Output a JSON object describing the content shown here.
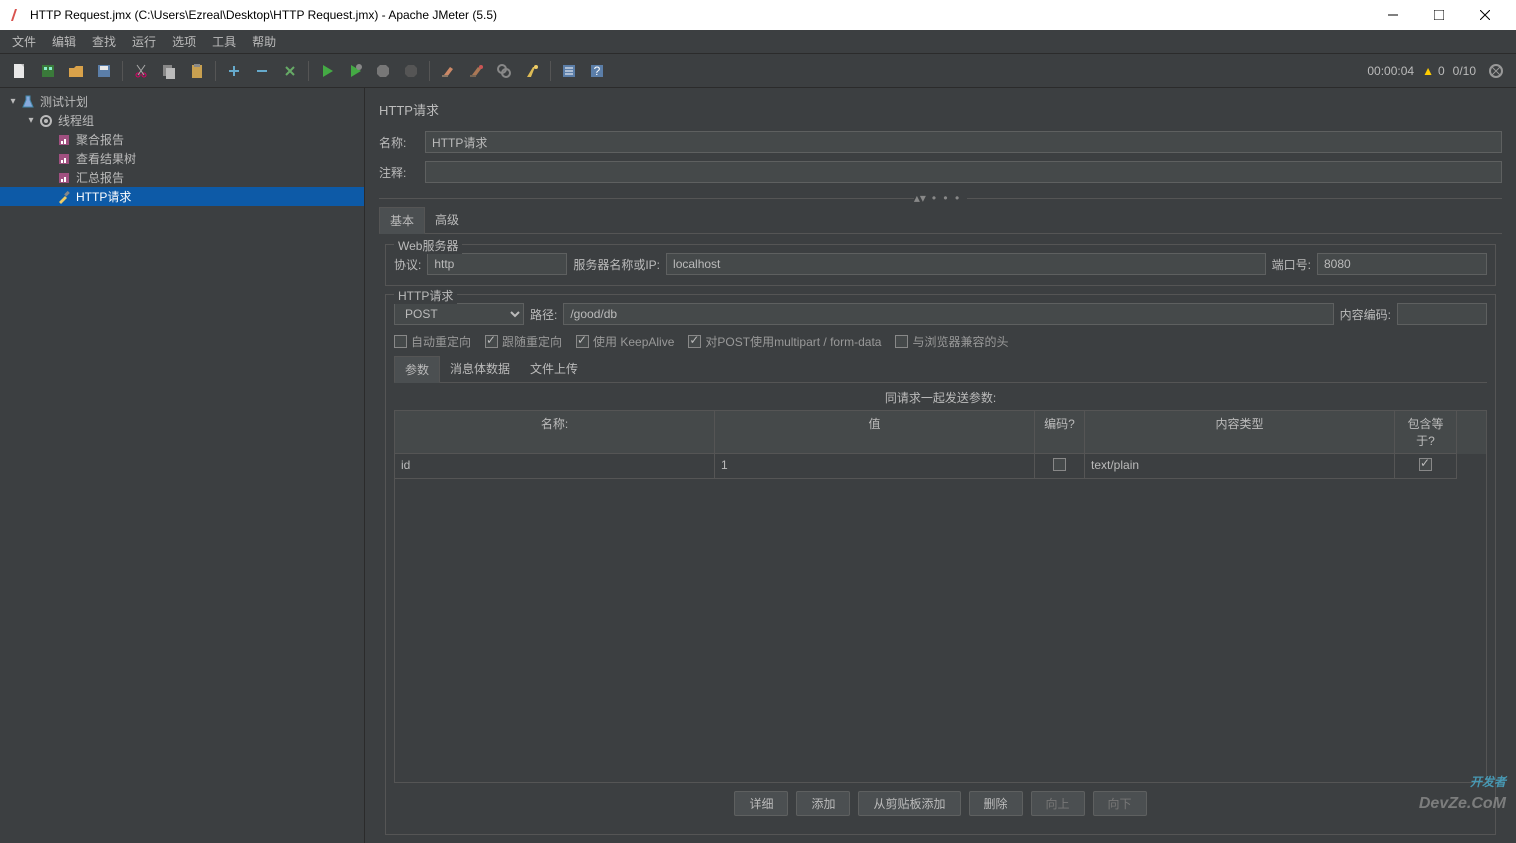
{
  "window": {
    "title": "HTTP Request.jmx (C:\\Users\\Ezreal\\Desktop\\HTTP Request.jmx) - Apache JMeter (5.5)"
  },
  "menu": [
    "文件",
    "编辑",
    "查找",
    "运行",
    "选项",
    "工具",
    "帮助"
  ],
  "status": {
    "timer": "00:00:04",
    "warn": "0",
    "threads": "0/10"
  },
  "tree": [
    {
      "indent": 0,
      "label": "测试计划",
      "icon": "flask",
      "tw": "▾"
    },
    {
      "indent": 1,
      "label": "线程组",
      "icon": "gear",
      "tw": "▾"
    },
    {
      "indent": 2,
      "label": "聚合报告",
      "icon": "report"
    },
    {
      "indent": 2,
      "label": "查看结果树",
      "icon": "report"
    },
    {
      "indent": 2,
      "label": "汇总报告",
      "icon": "report"
    },
    {
      "indent": 2,
      "label": "HTTP请求",
      "icon": "dropper",
      "sel": true
    }
  ],
  "main": {
    "title": "HTTP请求",
    "nameLabel": "名称:",
    "nameValue": "HTTP请求",
    "commentLabel": "注释:",
    "commentValue": "",
    "tabs": {
      "basic": "基本",
      "advanced": "高级"
    },
    "webserver": {
      "legend": "Web服务器",
      "protocolLabel": "协议:",
      "protocol": "http",
      "serverLabel": "服务器名称或IP:",
      "server": "localhost",
      "portLabel": "端口号:",
      "port": "8080"
    },
    "httpreq": {
      "legend": "HTTP请求",
      "method": "POST",
      "pathLabel": "路径:",
      "path": "/good/db",
      "encodingLabel": "内容编码:",
      "encoding": "",
      "cb": {
        "autoRedirect": "自动重定向",
        "followRedirect": "跟随重定向",
        "keepAlive": "使用 KeepAlive",
        "multipart": "对POST使用multipart / form-data",
        "browserCompat": "与浏览器兼容的头"
      }
    },
    "subtabs": {
      "params": "参数",
      "body": "消息体数据",
      "files": "文件上传"
    },
    "paramsCaption": "同请求一起发送参数:",
    "paramCols": {
      "name": "名称:",
      "value": "值",
      "encode": "编码?",
      "type": "内容类型",
      "include": "包含等于?"
    },
    "paramRows": [
      {
        "name": "id",
        "value": "1",
        "encode": false,
        "type": "text/plain",
        "include": true
      }
    ],
    "buttons": {
      "detail": "详细",
      "add": "添加",
      "clip": "从剪贴板添加",
      "del": "删除",
      "up": "向上",
      "down": "向下"
    }
  },
  "watermark": {
    "line1": "开发者",
    "line2": "DevZe.CoM"
  }
}
